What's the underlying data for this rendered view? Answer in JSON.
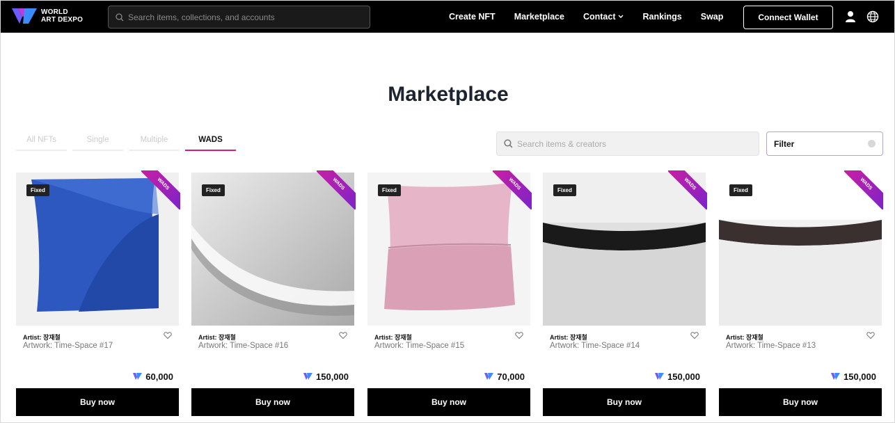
{
  "nav": {
    "logo_line1": "WORLD",
    "logo_line2": "ART DEXPO",
    "search_placeholder": "Search items, collections, and accounts",
    "links": [
      "Create NFT",
      "Marketplace",
      "Contact",
      "Rankings",
      "Swap"
    ],
    "connect_label": "Connect Wallet",
    "icons": [
      "user-icon",
      "globe-icon"
    ]
  },
  "main": {
    "title": "Marketplace",
    "tabs": [
      {
        "label": "All NFTs",
        "active": false
      },
      {
        "label": "Single",
        "active": false
      },
      {
        "label": "Multiple",
        "active": false
      },
      {
        "label": "WADS",
        "active": true
      }
    ],
    "search_placeholder": "Search items & creators",
    "filter_label": "Filter"
  },
  "cards": [
    {
      "badge": "Fixed",
      "ribbon": "WADS",
      "artist": "Artist: 장재철",
      "artwork": "Artwork: Time-Space #17",
      "price": "60,000",
      "buy": "Buy now"
    },
    {
      "badge": "Fixed",
      "ribbon": "WADS",
      "artist": "Artist: 장재철",
      "artwork": "Artwork: Time-Space #16",
      "price": "150,000",
      "buy": "Buy now"
    },
    {
      "badge": "Fixed",
      "ribbon": "WADS",
      "artist": "Artist: 장재철",
      "artwork": "Artwork: Time-Space #15",
      "price": "70,000",
      "buy": "Buy now"
    },
    {
      "badge": "Fixed",
      "ribbon": "WADS",
      "artist": "Artist: 장재철",
      "artwork": "Artwork: Time-Space #14",
      "price": "150,000",
      "buy": "Buy now"
    },
    {
      "badge": "Fixed",
      "ribbon": "WADS",
      "artist": "Artist: 장재철",
      "artwork": "Artwork: Time-Space #13",
      "price": "150,000",
      "buy": "Buy now"
    }
  ],
  "colors": {
    "accent": "#d11a7a",
    "ribbon_start": "#d01ea0",
    "ribbon_end": "#7a24c8",
    "navbar": "#000000"
  }
}
